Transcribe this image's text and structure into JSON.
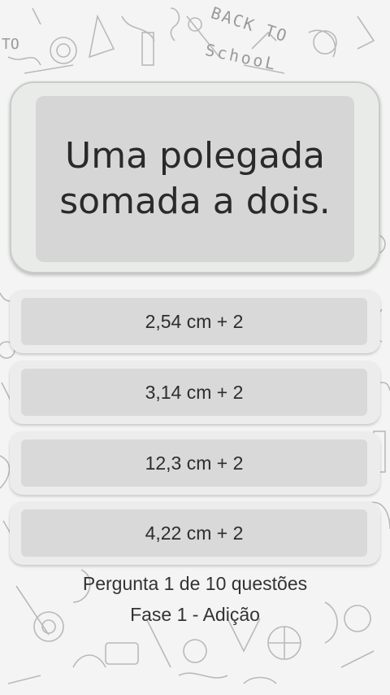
{
  "background": {
    "doodle_text": [
      "BACK TO",
      "SchooL",
      "TO"
    ]
  },
  "question": {
    "text": "Uma polegada somada a dois."
  },
  "answers": [
    {
      "label": "2,54 cm + 2"
    },
    {
      "label": "3,14 cm + 2"
    },
    {
      "label": "12,3 cm + 2"
    },
    {
      "label": "4,22 cm + 2"
    }
  ],
  "footer": {
    "progress": "Pergunta 1 de 10 questões",
    "phase": "Fase 1 - Adição"
  }
}
